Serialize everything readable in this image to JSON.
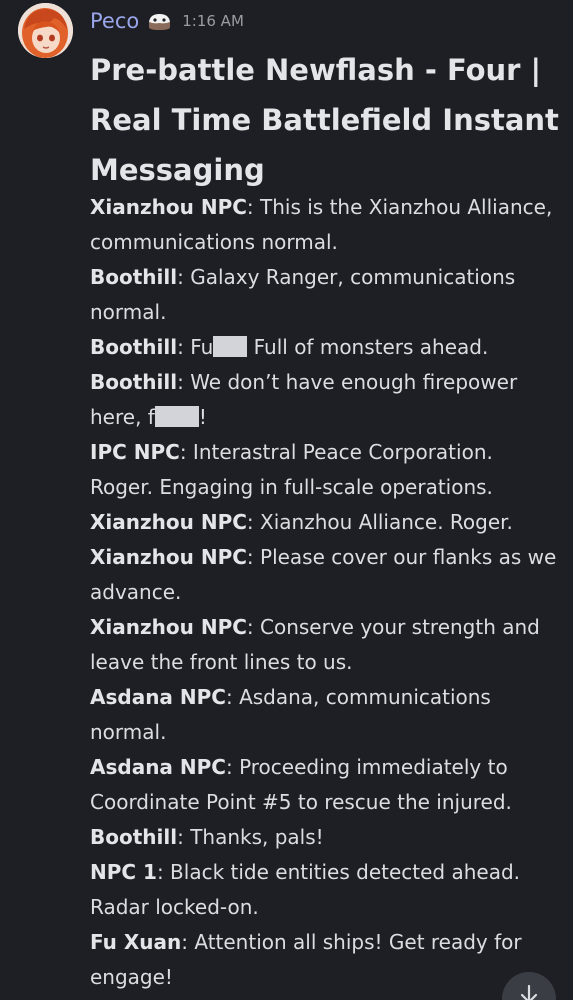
{
  "author": {
    "username": "Peco",
    "timestamp": "1:16 AM",
    "badge_icon": "snowy-cake-icon",
    "avatar_icon": "anime-avatar-icon",
    "name_color": "#9aa6ea"
  },
  "post": {
    "title": "Pre-battle Newflash - Four | Real Time Battlefield Instant Messaging",
    "lines": [
      {
        "speaker": "Xianzhou NPC",
        "text": ": This is the Xianzhou Alliance, communications normal."
      },
      {
        "speaker": "Boothill",
        "text": ": Galaxy Ranger, communications normal."
      },
      {
        "speaker": "Boothill",
        "text_a": ": Fu",
        "text_b": " Full of monsters ahead."
      },
      {
        "speaker": "Boothill",
        "text_a": ": We don’t have enough firepower here, f",
        "text_b": "!"
      },
      {
        "speaker": "IPC NPC",
        "text": ": Interastral Peace Corporation. Roger. Engaging in full-scale operations."
      },
      {
        "speaker": "Xianzhou NPC",
        "text": ": Xianzhou Alliance. Roger."
      },
      {
        "speaker": "Xianzhou NPC",
        "text": ": Please cover our flanks as we advance."
      },
      {
        "speaker": "Xianzhou NPC",
        "text": ": Conserve your strength and leave the front lines to us."
      },
      {
        "speaker": "Asdana NPC",
        "text": ": Asdana, communications normal."
      },
      {
        "speaker": "Asdana NPC",
        "text": ": Proceeding immediately to Coordinate Point #5 to rescue the injured."
      },
      {
        "speaker": "Boothill",
        "text": ": Thanks, pals!"
      },
      {
        "speaker": "NPC 1",
        "text": ": Black tide entities detected ahead. Radar locked-on."
      },
      {
        "speaker": "Fu Xuan",
        "text": ": Attention all ships! Get ready for engage!"
      }
    ]
  },
  "scroll_button": {
    "icon": "arrow-down-icon"
  }
}
